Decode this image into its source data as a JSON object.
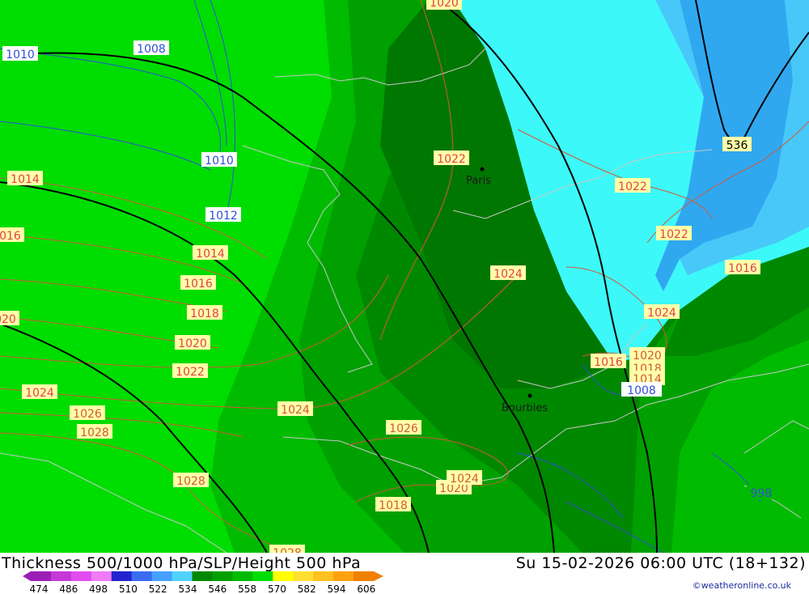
{
  "title": "Thickness 500/1000 hPa/SLP/Height 500 hPa",
  "datetime": "Su 15-02-2026 06:00 UTC (18+132)",
  "credit": "©weatheronline.co.uk",
  "cities": [
    {
      "name": "Paris"
    },
    {
      "name": "Bourbies"
    }
  ],
  "contour_labels": {
    "slp_red": [
      "1020",
      "1022",
      "1022",
      "1022",
      "1024",
      "1016",
      "1024",
      "1016",
      "1014",
      "1016",
      "1018",
      "1020",
      "1022",
      "1024",
      "1026",
      "1028",
      "1028",
      "1014",
      "1016",
      "1020",
      "1024",
      "1026",
      "1018",
      "1024",
      "1020",
      "1018",
      "1014",
      "1028",
      "1026",
      "1020"
    ],
    "slp_blue": [
      "1010",
      "1008",
      "1010",
      "1012",
      "998",
      "1008"
    ],
    "height_black": [
      "536"
    ]
  },
  "legend": {
    "values": [
      "474",
      "486",
      "498",
      "510",
      "522",
      "534",
      "546",
      "558",
      "570",
      "582",
      "594",
      "606"
    ],
    "colors": [
      "#9b1fb5",
      "#c53ad6",
      "#e14cf0",
      "#f07cf7",
      "#2424d0",
      "#3a6cf0",
      "#46a0ff",
      "#50d2ff",
      "#008800",
      "#00a000",
      "#00bb00",
      "#00dd00",
      "#ffff00",
      "#ffe030",
      "#ffc020",
      "#ffa010",
      "#f08000"
    ]
  },
  "palette": {
    "light_green": "#00dd00",
    "mid_green": "#00bb00",
    "green": "#00a000",
    "dark_green": "#008800",
    "darker_green": "#007700",
    "cyan": "#3df8f8",
    "light_blue": "#48c8f8",
    "blue": "#30a8f0"
  }
}
